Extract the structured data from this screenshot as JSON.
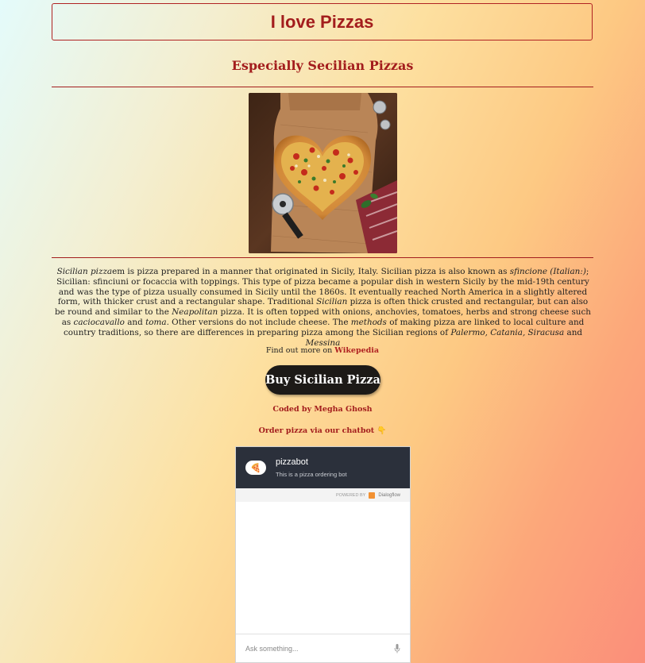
{
  "header": {
    "title": "I love Pizzas",
    "subtitle": "Especially Secilian Pizzas"
  },
  "image": {
    "alt": "Heart-shaped pizza on a wooden board"
  },
  "description": {
    "p1": "Sicilian pizza",
    "p2": "em is pizza prepared in a manner that originated in Sicily, Italy. Sicilian pizza is also known as ",
    "p3": "sfincione (Italian:)",
    "p4": "; Sicilian: sfinciuni or focaccia with toppings. This type of pizza became a popular dish in western Sicily by the mid-19th century and was the type of pizza usually consumed in Sicily until the 1860s. It eventually reached North America in a slightly altered form, with thicker crust and a rectangular shape. Traditional ",
    "p5": "Sicilian",
    "p6": " pizza is often thick crusted and rectangular, but can also be round and similar to the ",
    "p7": "Neapolitan",
    "p8": " pizza. It is often topped with onions, anchovies, tomatoes, herbs and strong cheese such as ",
    "p9": "caciocavallo",
    "p10": " and ",
    "p11": "toma",
    "p12": ". Other versions do not include cheese. The ",
    "p13": "methods",
    "p14": " of making pizza are linked to local culture and country traditions, so there are differences in preparing pizza among the Sicilian regions of ",
    "p15": "Palermo, Catania, Siracusa",
    "p16": " and ",
    "p17": "Messina"
  },
  "findout": {
    "prefix": "Find out more on ",
    "link": "Wikepedia"
  },
  "buy_button": "Buy Sicilian Pizza",
  "credit": {
    "prefix": "Coded by ",
    "name": "Megha Ghosh"
  },
  "chat_cta": "Order pizza via our chatbot 👇",
  "chatbot": {
    "avatar": "🍕",
    "name": "pizzabot",
    "subtitle": "This is a pizza ordering bot",
    "powered_by": "POWERED BY",
    "provider": "Dialogflow",
    "input_placeholder": "Ask something..."
  },
  "colors": {
    "accent": "#a31d1d",
    "button": "#1d1a17",
    "chat_header": "#2b303b"
  }
}
